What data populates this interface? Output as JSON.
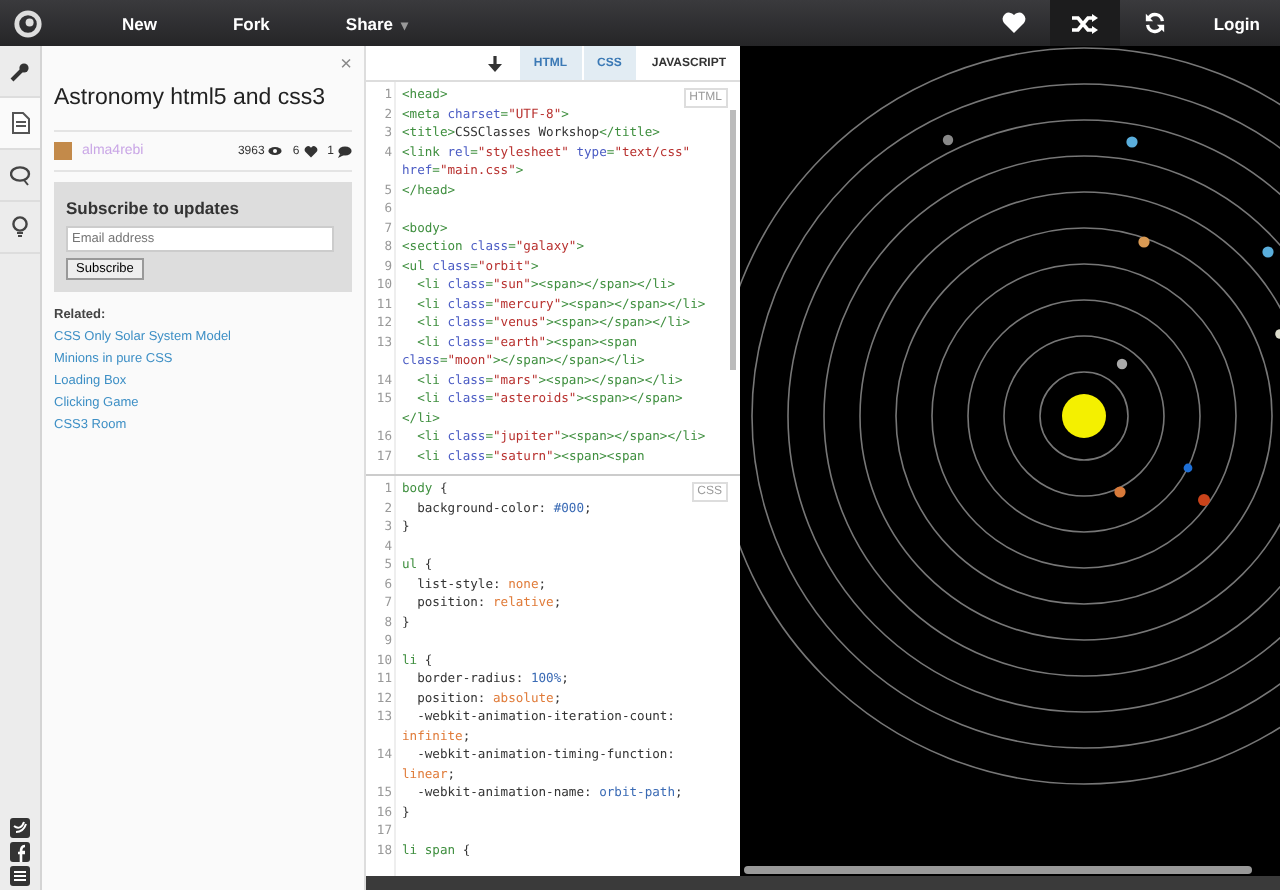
{
  "topbar": {
    "nav": [
      {
        "label": "New"
      },
      {
        "label": "Fork"
      },
      {
        "label": "Share",
        "caret": "▾"
      }
    ],
    "actions": [
      {
        "kind": "heart",
        "selected": false
      },
      {
        "kind": "shuffle",
        "selected": true
      },
      {
        "kind": "refresh",
        "selected": false
      }
    ],
    "login": "Login"
  },
  "rail": {
    "tools": [
      {
        "kind": "wrench",
        "selected": false
      },
      {
        "kind": "document",
        "selected": true
      },
      {
        "kind": "chat",
        "selected": false
      },
      {
        "kind": "bulb",
        "selected": false
      }
    ],
    "social": [
      {
        "kind": "twitter"
      },
      {
        "kind": "facebook"
      },
      {
        "kind": "other"
      }
    ]
  },
  "sidebar": {
    "close": "×",
    "title": "Astronomy html5 and css3",
    "author": "alma4rebi",
    "views": "3963",
    "likes": "6",
    "comments": "1",
    "subscribe": {
      "heading": "Subscribe to updates",
      "placeholder": "Email address",
      "button": "Subscribe"
    },
    "related_heading": "Related:",
    "related": [
      "CSS Only Solar System Model",
      "Minions in pure CSS",
      "Loading Box",
      "Clicking Game",
      "CSS3 Room"
    ]
  },
  "editor": {
    "tabs": [
      {
        "label": "HTML",
        "selected": true
      },
      {
        "label": "CSS",
        "selected": true
      },
      {
        "label": "JAVASCRIPT",
        "selected": false
      }
    ],
    "panes": [
      {
        "label": "HTML",
        "rows": [
          {
            "n": "1",
            "t": [
              {
                "kind": "tag",
                "text": "<head>"
              }
            ]
          },
          {
            "n": "2",
            "t": [
              {
                "kind": "tag",
                "text": "<meta "
              },
              {
                "kind": "attr",
                "text": "charset"
              },
              {
                "kind": "tag",
                "text": "="
              },
              {
                "kind": "str",
                "text": "\"UTF-8\""
              },
              {
                "kind": "tag",
                "text": ">"
              }
            ]
          },
          {
            "n": "3",
            "t": [
              {
                "kind": "tag",
                "text": "<title>"
              },
              {
                "kind": "txt",
                "text": "CSSClasses Workshop"
              },
              {
                "kind": "tag",
                "text": "</title>"
              }
            ]
          },
          {
            "n": "4",
            "t": [
              {
                "kind": "tag",
                "text": "<link "
              },
              {
                "kind": "attr",
                "text": "rel"
              },
              {
                "kind": "tag",
                "text": "="
              },
              {
                "kind": "str",
                "text": "\"stylesheet\""
              },
              {
                "kind": "attr",
                "text": " type"
              },
              {
                "kind": "tag",
                "text": "="
              },
              {
                "kind": "str",
                "text": "\"text/css\""
              }
            ]
          },
          {
            "t": [
              {
                "kind": "attr",
                "text": "href"
              },
              {
                "kind": "tag",
                "text": "="
              },
              {
                "kind": "str",
                "text": "\"main.css\""
              },
              {
                "kind": "tag",
                "text": ">"
              }
            ]
          },
          {
            "n": "5",
            "t": [
              {
                "kind": "tag",
                "text": "</head>"
              }
            ]
          },
          {
            "n": "6",
            "t": []
          },
          {
            "n": "7",
            "t": [
              {
                "kind": "tag",
                "text": "<body>"
              }
            ]
          },
          {
            "n": "8",
            "t": [
              {
                "kind": "tag",
                "text": "<section "
              },
              {
                "kind": "attr",
                "text": "class"
              },
              {
                "kind": "tag",
                "text": "="
              },
              {
                "kind": "str",
                "text": "\"galaxy\""
              },
              {
                "kind": "tag",
                "text": ">"
              }
            ]
          },
          {
            "n": "9",
            "t": [
              {
                "kind": "tag",
                "text": "<ul "
              },
              {
                "kind": "attr",
                "text": "class"
              },
              {
                "kind": "tag",
                "text": "="
              },
              {
                "kind": "str",
                "text": "\"orbit\""
              },
              {
                "kind": "tag",
                "text": ">"
              }
            ]
          },
          {
            "n": "10",
            "t": [
              {
                "kind": "tag",
                "text": "  <li "
              },
              {
                "kind": "attr",
                "text": "class"
              },
              {
                "kind": "tag",
                "text": "="
              },
              {
                "kind": "str",
                "text": "\"sun\""
              },
              {
                "kind": "tag",
                "text": "><span></span></li>"
              }
            ]
          },
          {
            "n": "11",
            "t": [
              {
                "kind": "tag",
                "text": "  <li "
              },
              {
                "kind": "attr",
                "text": "class"
              },
              {
                "kind": "tag",
                "text": "="
              },
              {
                "kind": "str",
                "text": "\"mercury\""
              },
              {
                "kind": "tag",
                "text": "><span></span></li>"
              }
            ]
          },
          {
            "n": "12",
            "t": [
              {
                "kind": "tag",
                "text": "  <li "
              },
              {
                "kind": "attr",
                "text": "class"
              },
              {
                "kind": "tag",
                "text": "="
              },
              {
                "kind": "str",
                "text": "\"venus\""
              },
              {
                "kind": "tag",
                "text": "><span></span></li>"
              }
            ]
          },
          {
            "n": "13",
            "t": [
              {
                "kind": "tag",
                "text": "  <li "
              },
              {
                "kind": "attr",
                "text": "class"
              },
              {
                "kind": "tag",
                "text": "="
              },
              {
                "kind": "str",
                "text": "\"earth\""
              },
              {
                "kind": "tag",
                "text": "><span><span"
              }
            ]
          },
          {
            "t": [
              {
                "kind": "attr",
                "text": "class"
              },
              {
                "kind": "tag",
                "text": "="
              },
              {
                "kind": "str",
                "text": "\"moon\""
              },
              {
                "kind": "tag",
                "text": "></span></span></li>"
              }
            ]
          },
          {
            "n": "14",
            "t": [
              {
                "kind": "tag",
                "text": "  <li "
              },
              {
                "kind": "attr",
                "text": "class"
              },
              {
                "kind": "tag",
                "text": "="
              },
              {
                "kind": "str",
                "text": "\"mars\""
              },
              {
                "kind": "tag",
                "text": "><span></span></li>"
              }
            ]
          },
          {
            "n": "15",
            "t": [
              {
                "kind": "tag",
                "text": "  <li "
              },
              {
                "kind": "attr",
                "text": "class"
              },
              {
                "kind": "tag",
                "text": "="
              },
              {
                "kind": "str",
                "text": "\"asteroids\""
              },
              {
                "kind": "tag",
                "text": "><span></span>"
              }
            ]
          },
          {
            "t": [
              {
                "kind": "tag",
                "text": "</li>"
              }
            ]
          },
          {
            "n": "16",
            "t": [
              {
                "kind": "tag",
                "text": "  <li "
              },
              {
                "kind": "attr",
                "text": "class"
              },
              {
                "kind": "tag",
                "text": "="
              },
              {
                "kind": "str",
                "text": "\"jupiter\""
              },
              {
                "kind": "tag",
                "text": "><span></span></li>"
              }
            ]
          },
          {
            "n": "17",
            "t": [
              {
                "kind": "tag",
                "text": "  <li "
              },
              {
                "kind": "attr",
                "text": "class"
              },
              {
                "kind": "tag",
                "text": "="
              },
              {
                "kind": "str",
                "text": "\"saturn\""
              },
              {
                "kind": "tag",
                "text": "><span><span"
              }
            ]
          }
        ]
      },
      {
        "label": "CSS",
        "rows": [
          {
            "n": "1",
            "t": [
              {
                "kind": "sel",
                "text": "body"
              },
              {
                "kind": "txt",
                "text": " {"
              }
            ]
          },
          {
            "n": "2",
            "t": [
              {
                "kind": "txt",
                "text": "  background-color: "
              },
              {
                "kind": "num",
                "text": "#000"
              },
              {
                "kind": "txt",
                "text": ";"
              }
            ]
          },
          {
            "n": "3",
            "t": [
              {
                "kind": "txt",
                "text": "}"
              }
            ]
          },
          {
            "n": "4",
            "t": []
          },
          {
            "n": "5",
            "t": [
              {
                "kind": "sel",
                "text": "ul"
              },
              {
                "kind": "txt",
                "text": " {"
              }
            ]
          },
          {
            "n": "6",
            "t": [
              {
                "kind": "txt",
                "text": "  list-style: "
              },
              {
                "kind": "val",
                "text": "none"
              },
              {
                "kind": "txt",
                "text": ";"
              }
            ]
          },
          {
            "n": "7",
            "t": [
              {
                "kind": "txt",
                "text": "  position: "
              },
              {
                "kind": "val",
                "text": "relative"
              },
              {
                "kind": "txt",
                "text": ";"
              }
            ]
          },
          {
            "n": "8",
            "t": [
              {
                "kind": "txt",
                "text": "}"
              }
            ]
          },
          {
            "n": "9",
            "t": []
          },
          {
            "n": "10",
            "t": [
              {
                "kind": "sel",
                "text": "li"
              },
              {
                "kind": "txt",
                "text": " {"
              }
            ]
          },
          {
            "n": "11",
            "t": [
              {
                "kind": "txt",
                "text": "  border-radius: "
              },
              {
                "kind": "num",
                "text": "100%"
              },
              {
                "kind": "txt",
                "text": ";"
              }
            ]
          },
          {
            "n": "12",
            "t": [
              {
                "kind": "txt",
                "text": "  position: "
              },
              {
                "kind": "val",
                "text": "absolute"
              },
              {
                "kind": "txt",
                "text": ";"
              }
            ]
          },
          {
            "n": "13",
            "t": [
              {
                "kind": "txt",
                "text": "  -webkit-animation-iteration-count:"
              }
            ]
          },
          {
            "t": [
              {
                "kind": "val",
                "text": "infinite"
              },
              {
                "kind": "txt",
                "text": ";"
              }
            ]
          },
          {
            "n": "14",
            "t": [
              {
                "kind": "txt",
                "text": "  -webkit-animation-timing-function:"
              }
            ]
          },
          {
            "t": [
              {
                "kind": "val",
                "text": "linear"
              },
              {
                "kind": "txt",
                "text": ";"
              }
            ]
          },
          {
            "n": "15",
            "t": [
              {
                "kind": "txt",
                "text": "  -webkit-animation-name: "
              },
              {
                "kind": "num",
                "text": "orbit-path"
              },
              {
                "kind": "txt",
                "text": ";"
              }
            ]
          },
          {
            "n": "16",
            "t": [
              {
                "kind": "txt",
                "text": "}"
              }
            ]
          },
          {
            "n": "17",
            "t": []
          },
          {
            "n": "18",
            "t": [
              {
                "kind": "sel",
                "text": "li span"
              },
              {
                "kind": "txt",
                "text": " {"
              }
            ]
          }
        ]
      }
    ]
  }
}
